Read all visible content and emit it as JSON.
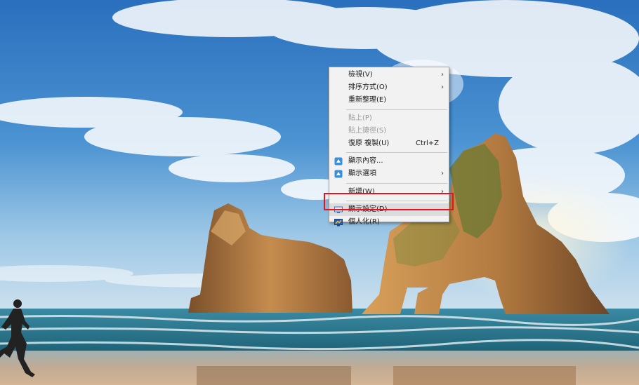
{
  "colors": {
    "sky_top": "#2f79c4",
    "sky_bottom": "#b8d7ea",
    "sea": "#2e7f96",
    "sand": "#c9a98a",
    "rock": "#b07a44",
    "menu_bg": "#f2f2f2",
    "highlight_frame": "#e3141e"
  },
  "context_menu": {
    "items": [
      {
        "label": "檢視(V)",
        "submenu": true,
        "icon": null
      },
      {
        "label": "排序方式(O)",
        "submenu": true,
        "icon": null
      },
      {
        "label": "重新整理(E)",
        "icon": null
      },
      {
        "separator": true
      },
      {
        "label": "貼上(P)",
        "disabled": true,
        "icon": null
      },
      {
        "label": "貼上捷徑(S)",
        "disabled": true,
        "icon": null
      },
      {
        "label": "復原 複製(U)",
        "shortcut": "Ctrl+Z",
        "icon": null
      },
      {
        "separator": true
      },
      {
        "label": "顯示內容...",
        "icon": "display-properties-icon"
      },
      {
        "label": "顯示選項",
        "submenu": true,
        "icon": "display-options-icon"
      },
      {
        "separator": true
      },
      {
        "label": "新增(W)",
        "submenu": true,
        "icon": null
      },
      {
        "separator": true
      },
      {
        "label": "顯示設定(D)",
        "icon": "display-settings-icon",
        "highlighted": true
      },
      {
        "label": "個人化(R)",
        "icon": "personalize-icon"
      }
    ],
    "submenu_glyph": "›"
  }
}
